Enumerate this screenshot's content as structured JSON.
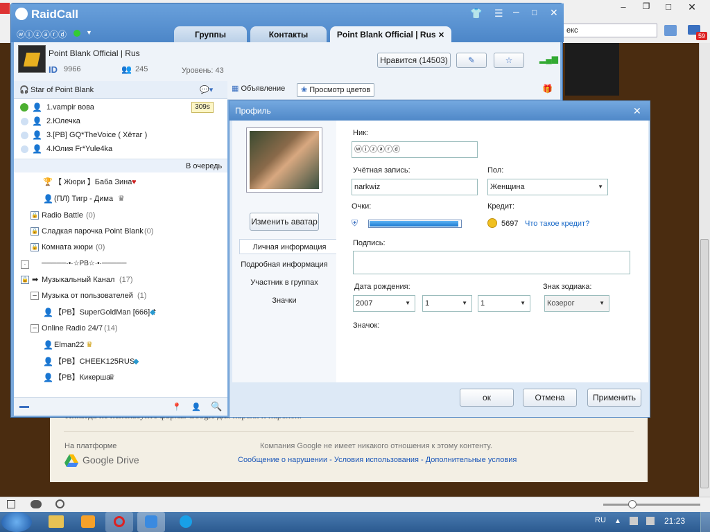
{
  "browser": {
    "search_placeholder": "екс",
    "mail_count": "59",
    "footer_platform_label": "На платформе",
    "footer_platform_name": "Google Drive",
    "footer_note": "Компания Google не имеет никакого отношения к этому контенту.",
    "footer_links": "Сообщение о нарушении - Условия использования - Дополнительные условия",
    "partial_text": "Никогда не используйте формы Google для пароля и паролей."
  },
  "raidcall": {
    "app_name": "RaidCall",
    "username": "ⓦⓘⓩⓐⓡⓓ",
    "tabs": [
      "Группы",
      "Контакты",
      "Point Blank Official | Rus"
    ],
    "group": {
      "name": "Point Blank Official | Rus",
      "id_label": "ID",
      "id": "9966",
      "members": "245",
      "level": "Уровень: 43",
      "like_button": "Нравится (14503)"
    },
    "channel_header": "Star of Point Blank",
    "timer_badge": "309s",
    "queue": [
      "1.vampir вова",
      "2.Юлечка",
      "3.[PB] GQ*TheVoice ( Хётаг )",
      "4.Юлия Fr*Yule4ka"
    ],
    "queue_label": "В очередь",
    "tree": [
      "【 Жюри 】Баба Зина",
      "(ПЛ) Тигр - Дима",
      "Radio Battle",
      "Сладкая парочка Point Blank",
      "Комната жюри",
      "─────·•·☆PB☆·•·─────",
      "Музыкальный Канал",
      "Музыка от пользователей",
      "【PB】SuperGoldMan [666] †",
      "Online Radio 24/7",
      "Elman22",
      "【PB】CHEEK125RUS",
      "【PB】Кикерша"
    ],
    "tree_counts": [
      "(0)",
      "(0)",
      "(0)",
      "(17)",
      "(1)",
      "(14)"
    ],
    "announce_label": "Объявление",
    "flowers_label": "Просмотр цветов"
  },
  "profile": {
    "title": "Профиль",
    "change_avatar": "Изменить аватар",
    "nav": [
      "Личная информация",
      "Подробная информация",
      "Участник в группах",
      "Значки"
    ],
    "nick_label": "Ник:",
    "nick_value": "ⓦⓘⓩⓐⓡⓓ",
    "account_label": "Учётная запись:",
    "account_value": "narkwiz",
    "gender_label": "Пол:",
    "gender_value": "Женщина",
    "points_label": "Очки:",
    "credit_label": "Кредит:",
    "credit_value": "5697",
    "credit_link": "Что такое кредит?",
    "signature_label": "Подпись:",
    "birth_label": "Дата рождения:",
    "birth_year": "2007",
    "birth_month": "1",
    "birth_day": "1",
    "zodiac_label": "Знак зодиака:",
    "zodiac_value": "Козерог",
    "badge_label": "Значок:",
    "ok": "ок",
    "cancel": "Отмена",
    "apply": "Применить"
  },
  "taskbar": {
    "lang": "RU",
    "time": "21:23"
  },
  "colors": {
    "accent": "#4c86c8",
    "progress": "#2f8ee0"
  }
}
